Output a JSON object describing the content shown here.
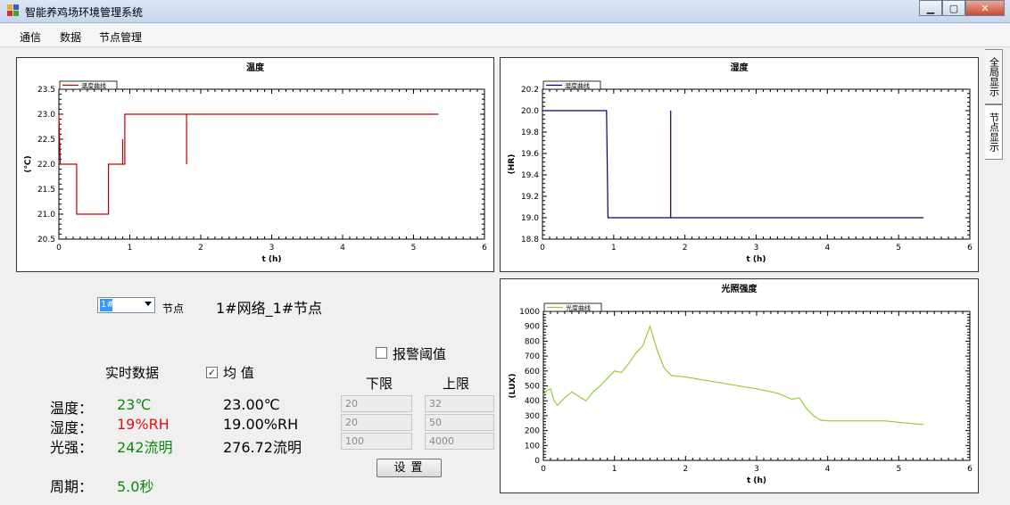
{
  "window": {
    "title": "智能养鸡场环境管理系统",
    "min_label": "▁",
    "max_label": "▢",
    "close_label": "✕"
  },
  "menu": [
    "通信",
    "数据",
    "节点管理"
  ],
  "tabs": [
    "全局显示",
    "节点显示"
  ],
  "charts": {
    "temperature": {
      "title": "温度",
      "legend": "温度曲线",
      "ylabel": "(℃)",
      "xlabel": "t (h)",
      "color": "#c00000",
      "xlim": [
        0,
        6
      ],
      "ylim": [
        20.5,
        23.5
      ],
      "yticks": [
        "20.5",
        "21.0",
        "21.5",
        "22.0",
        "22.5",
        "23.0",
        "23.5"
      ],
      "xticks": [
        "0",
        "1",
        "2",
        "3",
        "4",
        "5",
        "6"
      ],
      "points": [
        [
          0,
          23
        ],
        [
          0.02,
          22
        ],
        [
          0.25,
          22
        ],
        [
          0.25,
          21
        ],
        [
          0.7,
          21
        ],
        [
          0.7,
          22
        ],
        [
          0.9,
          22
        ],
        [
          0.9,
          22.5
        ],
        [
          0.9,
          22
        ],
        [
          0.93,
          22
        ],
        [
          0.93,
          23
        ],
        [
          1.8,
          23
        ],
        [
          1.8,
          22
        ],
        [
          1.8,
          23
        ],
        [
          5.35,
          23
        ]
      ]
    },
    "humidity": {
      "title": "湿度",
      "legend": "湿度曲线",
      "ylabel": "(HR)",
      "xlabel": "t (h)",
      "color": "#000080",
      "xlim": [
        0,
        6
      ],
      "ylim": [
        18.8,
        20.2
      ],
      "yticks": [
        "18.8",
        "19.0",
        "19.2",
        "19.4",
        "19.6",
        "19.8",
        "20.0",
        "20.2"
      ],
      "xticks": [
        "0",
        "1",
        "2",
        "3",
        "4",
        "5",
        "6"
      ],
      "points": [
        [
          0,
          20
        ],
        [
          0.9,
          20
        ],
        [
          0.92,
          19
        ],
        [
          1.8,
          19
        ],
        [
          1.8,
          20
        ],
        [
          1.8,
          19
        ],
        [
          5.35,
          19
        ]
      ]
    },
    "light": {
      "title": "光照强度",
      "legend": "光度曲线",
      "ylabel": "(LUX)",
      "xlabel": "t (h)",
      "color": "#99cc33",
      "xlim": [
        0,
        6
      ],
      "ylim": [
        0,
        1000
      ],
      "yticks": [
        "0",
        "100",
        "200",
        "300",
        "400",
        "500",
        "600",
        "700",
        "800",
        "900",
        "1000"
      ],
      "xticks": [
        "0",
        "1",
        "2",
        "3",
        "4",
        "5",
        "6"
      ],
      "points": [
        [
          0,
          440
        ],
        [
          0.05,
          470
        ],
        [
          0.1,
          480
        ],
        [
          0.15,
          400
        ],
        [
          0.2,
          370
        ],
        [
          0.3,
          420
        ],
        [
          0.4,
          460
        ],
        [
          0.5,
          430
        ],
        [
          0.6,
          400
        ],
        [
          0.7,
          460
        ],
        [
          0.8,
          500
        ],
        [
          0.9,
          550
        ],
        [
          1.0,
          600
        ],
        [
          1.1,
          590
        ],
        [
          1.2,
          650
        ],
        [
          1.3,
          720
        ],
        [
          1.4,
          770
        ],
        [
          1.5,
          900
        ],
        [
          1.55,
          820
        ],
        [
          1.6,
          740
        ],
        [
          1.7,
          620
        ],
        [
          1.8,
          570
        ],
        [
          2.0,
          560
        ],
        [
          2.5,
          520
        ],
        [
          3.0,
          480
        ],
        [
          3.3,
          450
        ],
        [
          3.5,
          410
        ],
        [
          3.6,
          420
        ],
        [
          3.7,
          350
        ],
        [
          3.8,
          300
        ],
        [
          3.9,
          270
        ],
        [
          4.0,
          265
        ],
        [
          4.5,
          265
        ],
        [
          4.8,
          265
        ],
        [
          5.0,
          255
        ],
        [
          5.35,
          240
        ]
      ]
    }
  },
  "node": {
    "combo_value": "1#",
    "combo_label": "节点",
    "node_name": "1#网络_1#节点"
  },
  "realtime": {
    "heading": "实时数据",
    "avg_label": "均   值",
    "rows": [
      {
        "label": "温度：",
        "value": "23℃",
        "avg": "23.00℃",
        "color": "green"
      },
      {
        "label": "湿度：",
        "value": "19%RH",
        "avg": "19.00%RH",
        "color": "red"
      },
      {
        "label": "光强：",
        "value": "242流明",
        "avg": "276.72流明",
        "color": "green"
      }
    ],
    "period_label": "周期：",
    "period_value": "5.0秒"
  },
  "alarm": {
    "label": "报警阈值",
    "lower_label": "下限",
    "upper_label": "上限",
    "lower": [
      "20",
      "20",
      "100"
    ],
    "upper": [
      "32",
      "50",
      "4000"
    ],
    "set_button": "设置"
  }
}
